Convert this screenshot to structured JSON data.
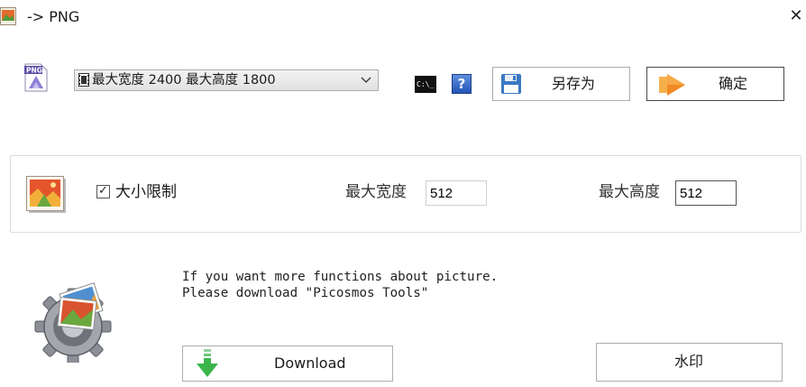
{
  "window": {
    "title": "-> PNG",
    "close_glyph": "✕"
  },
  "toolbar": {
    "format_icon": "png-file-icon",
    "preset": {
      "selected": "最大宽度 2400 最大高度 1800"
    },
    "cmd_icon_text": "C:\\_",
    "help_icon_text": "?",
    "save_as_label": "另存为",
    "ok_label": "确定"
  },
  "settings": {
    "size_limit_label": "大小限制",
    "size_limit_checked": true,
    "checkbox_glyph": "✓",
    "max_width_label": "最大宽度",
    "max_width_value": "512",
    "max_height_label": "最大高度",
    "max_height_value": "512"
  },
  "promo": {
    "line1": "If you want more functions about picture.",
    "line2": "Please download \"Picosmos Tools\"",
    "download_label": "Download",
    "watermark_label": "水印"
  },
  "colors": {
    "accent_orange": "#f08a24",
    "help_blue": "#2f62c4",
    "download_green": "#3bb54a"
  }
}
